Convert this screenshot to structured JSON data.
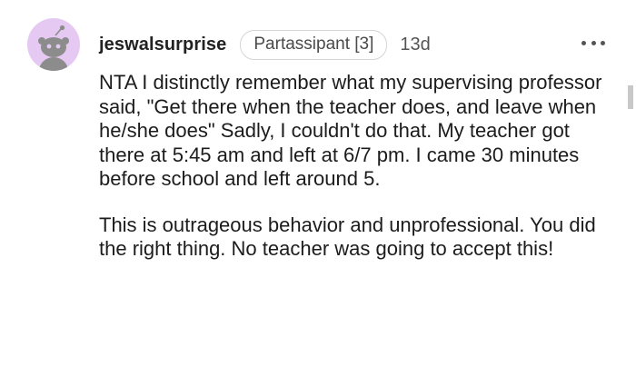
{
  "comment": {
    "username": "jeswalsurprise",
    "flair": "Partassipant [3]",
    "age": "13d",
    "paragraphs": [
      "NTA I distinctly remember what my supervising professor said, \"Get there when the teacher does, and leave when he/she does\" Sadly, I couldn't do that. My teacher got there at 5:45 am and left at 6/7 pm. I came 30 minutes before school and left around 5.",
      "This is outrageous behavior and unprofessional. You did the right thing. No teacher was going to accept this!"
    ],
    "avatar_bg": "#e6c9f2",
    "avatar_icon": "snoo-avatar-icon",
    "more_icon": "more-options-icon"
  }
}
